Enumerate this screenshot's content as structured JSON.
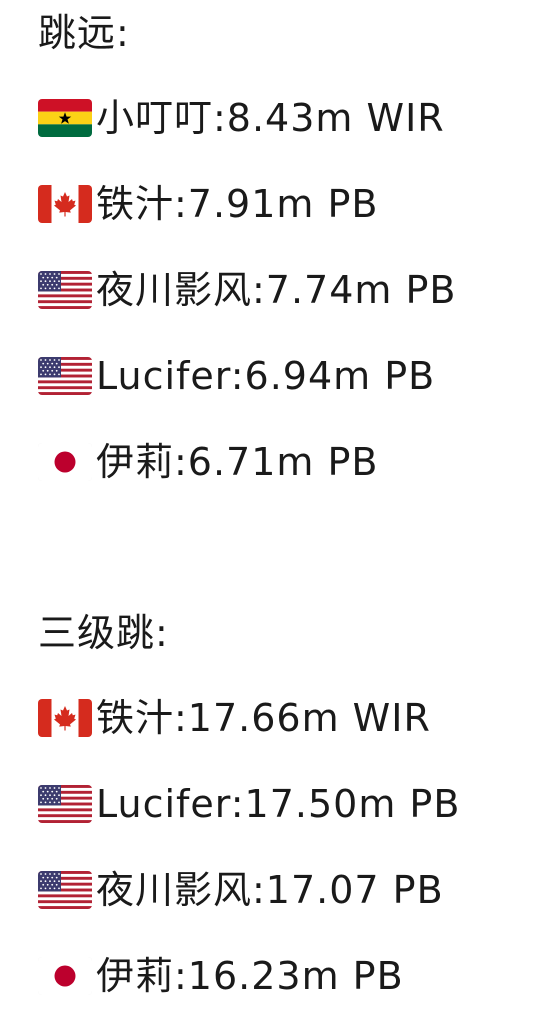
{
  "sections": [
    {
      "title": "跳远:",
      "entries": [
        {
          "flag": "ghana-flag-icon",
          "text": "小叮叮:8.43m WIR"
        },
        {
          "flag": "canada-flag-icon",
          "text": "铁汁:7.91m PB"
        },
        {
          "flag": "usa-flag-icon",
          "text": "夜川影风:7.74m PB"
        },
        {
          "flag": "usa-flag-icon",
          "text": "Lucifer:6.94m PB"
        },
        {
          "flag": "japan-flag-icon",
          "text": "伊莉:6.71m PB"
        }
      ]
    },
    {
      "title": "三级跳:",
      "entries": [
        {
          "flag": "canada-flag-icon",
          "text": "铁汁:17.66m WIR"
        },
        {
          "flag": "usa-flag-icon",
          "text": "Lucifer:17.50m PB"
        },
        {
          "flag": "usa-flag-icon",
          "text": "夜川影风:17.07 PB"
        },
        {
          "flag": "japan-flag-icon",
          "text": "伊莉:16.23m PB"
        }
      ]
    }
  ],
  "colors": {
    "text": "#1a1a1a",
    "ghana_red": "#ce1126",
    "ghana_gold": "#fcd116",
    "ghana_green": "#006b3f",
    "canada_red": "#d52b1e",
    "usa_red": "#b22234",
    "usa_blue": "#3c3b6e",
    "japan_red": "#bc002d"
  }
}
